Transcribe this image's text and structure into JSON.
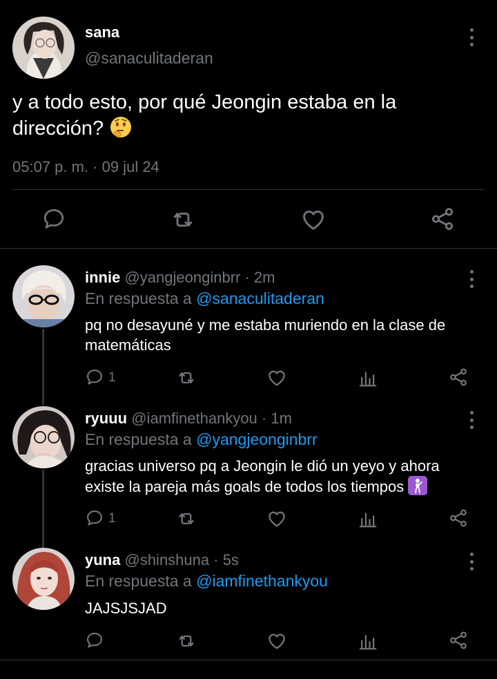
{
  "main_tweet": {
    "name": "sana",
    "handle": "@sanaculitaderan",
    "text": "y a todo esto, por qué Jeongin estaba en la dirección?",
    "timestamp": "05:07 p. m. · 09 jul 24"
  },
  "replies": [
    {
      "name": "innie",
      "handle": "@yangjeonginbrr",
      "time": "· 2m",
      "reply_prefix": "En respuesta a",
      "reply_to": "@sanaculitaderan",
      "text": "pq no desayuné y me estaba muriendo en la clase de matemáticas",
      "reply_count": "1"
    },
    {
      "name": "ryuuu",
      "handle": "@iamfinethankyou",
      "time": "· 1m",
      "reply_prefix": "En respuesta a",
      "reply_to": "@yangjeonginbrr",
      "text": "gracias universo pq a Jeongin le dió un yeyo y ahora existe la pareja más goals de todos los tiempos",
      "reply_count": "1"
    },
    {
      "name": "yuna",
      "handle": "@shinshuna",
      "time": "· 5s",
      "reply_prefix": "En respuesta a",
      "reply_to": "@iamfinethankyou",
      "text": "JAJSJSJAD",
      "reply_count": ""
    }
  ],
  "icons": [
    "comment-icon",
    "retweet-icon",
    "like-icon",
    "share-icon",
    "views-icon",
    "more-icon",
    "thinking-face-emoji",
    "woman-facepalming-emoji"
  ],
  "colors": {
    "background": "#000000",
    "text": "#e7e9ea",
    "muted": "#71767b",
    "link": "#1d9bf0",
    "divider": "#2f3336"
  }
}
